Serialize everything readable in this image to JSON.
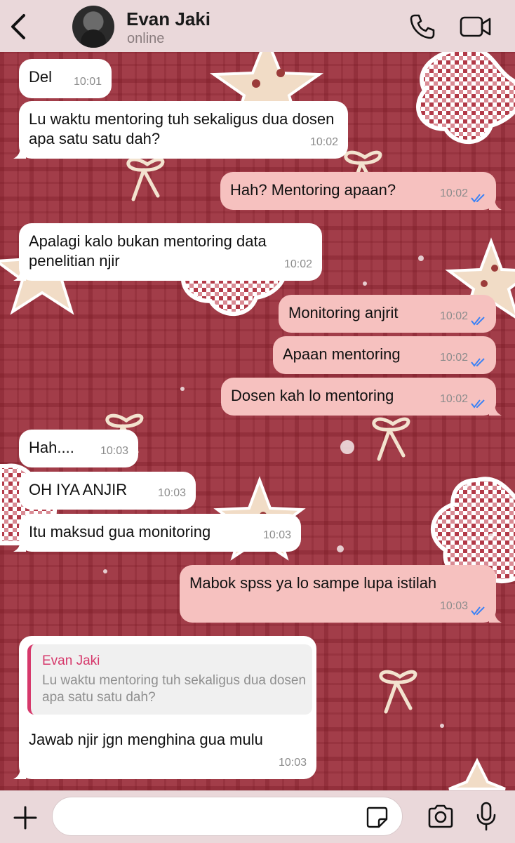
{
  "header": {
    "contact_name": "Evan Jaki",
    "status": "online",
    "back_icon": "chevron-left-icon",
    "call_icon": "phone-icon",
    "video_icon": "video-camera-icon"
  },
  "messages": [
    {
      "direction": "incoming",
      "text": "Del",
      "time": "10:01"
    },
    {
      "direction": "incoming",
      "text": "Lu waktu mentoring tuh sekaligus dua dosen apa satu satu dah?",
      "time": "10:02"
    },
    {
      "direction": "outgoing",
      "text": "Hah? Mentoring apaan?",
      "time": "10:02",
      "read": true
    },
    {
      "direction": "incoming",
      "text": "Apalagi kalo bukan mentoring data penelitian njir",
      "time": "10:02"
    },
    {
      "direction": "outgoing",
      "text": "Monitoring anjrit",
      "time": "10:02",
      "read": true
    },
    {
      "direction": "outgoing",
      "text": "Apaan mentoring",
      "time": "10:02",
      "read": true
    },
    {
      "direction": "outgoing",
      "text": "Dosen kah lo mentoring",
      "time": "10:02",
      "read": true
    },
    {
      "direction": "incoming",
      "text": "Hah....",
      "time": "10:03"
    },
    {
      "direction": "incoming",
      "text": "OH IYA ANJIR",
      "time": "10:03"
    },
    {
      "direction": "incoming",
      "text": "Itu maksud gua monitoring",
      "time": "10:03"
    },
    {
      "direction": "outgoing",
      "text": "Mabok spss ya lo sampe lupa istilah",
      "time": "10:03",
      "read": true
    },
    {
      "direction": "incoming",
      "reply_to": {
        "author": "Evan Jaki",
        "text": "Lu waktu mentoring tuh sekaligus dua dosen apa satu satu dah?"
      },
      "text": "Jawab njir jgn menghina gua mulu",
      "time": "10:03"
    }
  ],
  "input_bar": {
    "placeholder": "",
    "value": "",
    "plus_icon": "plus-icon",
    "sticker_icon": "sticker-icon",
    "camera_icon": "camera-icon",
    "mic_icon": "microphone-icon"
  },
  "colors": {
    "header_bg": "#ead8da",
    "incoming_bubble": "#ffffff",
    "outgoing_bubble": "#f6c1bf",
    "read_ticks": "#3b82f6",
    "quote_accent": "#d6386b",
    "wallpaper": "#a23d49"
  }
}
